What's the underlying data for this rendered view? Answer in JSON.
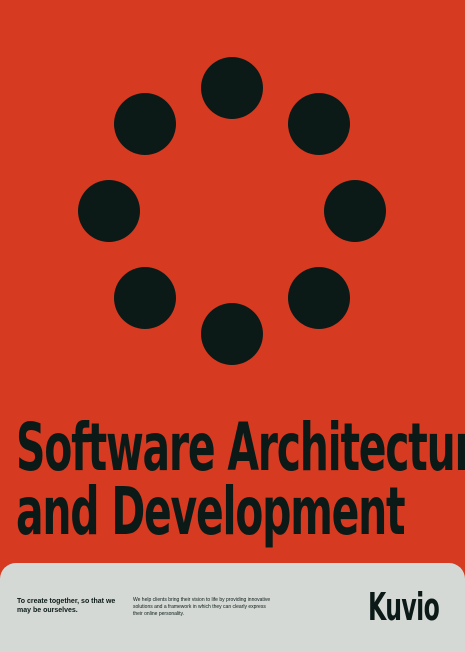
{
  "poster": {
    "background_color": "#d63a21",
    "ink_color": "#0c1a17",
    "footer_color": "#d4d9d5",
    "title_lines": [
      "Software Architecture",
      "and Development"
    ],
    "dots": {
      "count": 8,
      "arrangement": "ring"
    },
    "footer": {
      "tagline": "To create together, so that we may be ourselves.",
      "description": "We help clients bring their vision to life by providing innovative solutions and a framework in which they can clearly express their online personality.",
      "brand": "Kuvio"
    }
  }
}
